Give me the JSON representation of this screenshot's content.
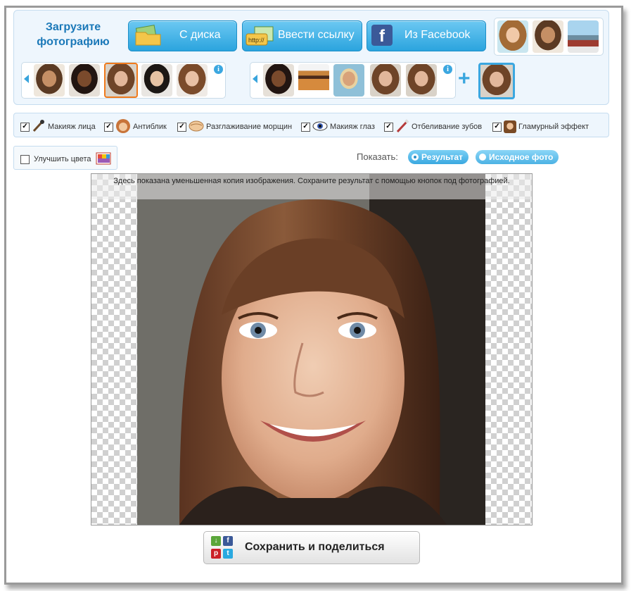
{
  "upload": {
    "title": "Загрузите фотографию",
    "from_disk": "С диска",
    "enter_link": "Ввести ссылку",
    "link_badge": "http://",
    "from_facebook": "Из Facebook",
    "facebook_glyph": "f"
  },
  "info_glyph": "i",
  "plus_glyph": "+",
  "options": [
    {
      "label": "Макияж лица",
      "checked": true,
      "icon": "brush-icon"
    },
    {
      "label": "Антиблик",
      "checked": true,
      "icon": "girl-face-icon"
    },
    {
      "label": "Разглаживание морщин",
      "checked": true,
      "icon": "smoothing-icon"
    },
    {
      "label": "Макияж глаз",
      "checked": true,
      "icon": "eye-icon"
    },
    {
      "label": "Отбеливание зубов",
      "checked": true,
      "icon": "toothbrush-icon"
    },
    {
      "label": "Гламурный эффект",
      "checked": true,
      "icon": "glamour-icon"
    }
  ],
  "check_mark": "✓",
  "enhance_colors": {
    "label": "Улучшить цвета",
    "checked": false
  },
  "show": {
    "label": "Показать:",
    "result": "Результат",
    "original": "Исходное фото",
    "selected": "Результат"
  },
  "preview_note": "Здесь показана уменьшенная копия изображения. Сохраните результат с помощью кнопок под фотографией.",
  "save_button": "Сохранить и поделиться",
  "share_icons": {
    "download": "↓",
    "facebook": "f",
    "pinterest": "p",
    "twitter": "t"
  },
  "colors": {
    "accent": "#2ba4de",
    "title": "#1a78b8",
    "selected_border": "#f07a1c"
  }
}
